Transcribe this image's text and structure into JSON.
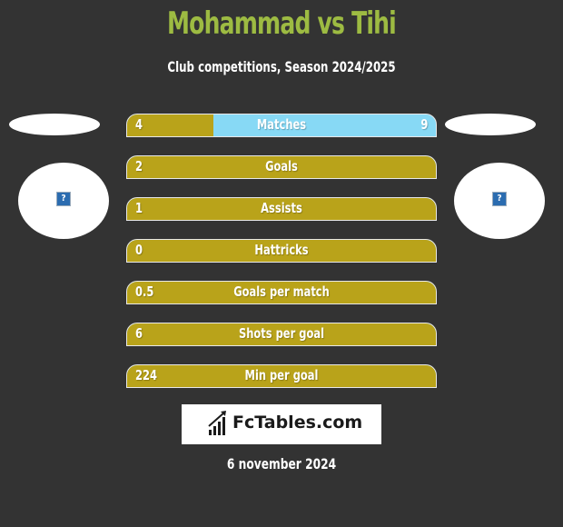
{
  "header": {
    "title": "Mohammad vs Tihi",
    "subtitle": "Club competitions, Season 2024/2025"
  },
  "players": {
    "left": {
      "name": "Mohammad",
      "logo_icon": "missing-image-icon"
    },
    "right": {
      "name": "Tihi",
      "logo_icon": "missing-image-icon"
    }
  },
  "colors": {
    "title": "#9dbb42",
    "left_bar": "#b9a31a",
    "right_bar": "#87d9f5",
    "background": "#333333"
  },
  "stats": [
    {
      "label": "Matches",
      "left": "4",
      "right": "9",
      "left_share": 0.28
    },
    {
      "label": "Goals",
      "left": "2",
      "right": "",
      "left_share": 1
    },
    {
      "label": "Assists",
      "left": "1",
      "right": "",
      "left_share": 1
    },
    {
      "label": "Hattricks",
      "left": "0",
      "right": "",
      "left_share": 1
    },
    {
      "label": "Goals per match",
      "left": "0.5",
      "right": "",
      "left_share": 1
    },
    {
      "label": "Shots per goal",
      "left": "6",
      "right": "",
      "left_share": 1
    },
    {
      "label": "Min per goal",
      "left": "224",
      "right": "",
      "left_share": 1
    }
  ],
  "footer": {
    "brand": "FcTables.com",
    "brand_icon": "bar-chart-icon",
    "date": "6 november 2024"
  }
}
